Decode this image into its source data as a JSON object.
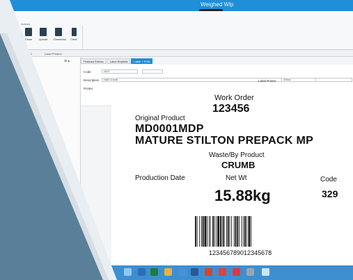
{
  "window": {
    "title": "Weighed Wlp"
  },
  "ribbon": {
    "group_label": "Actions",
    "buttons": [
      {
        "label": "Close",
        "icon": "close-icon"
      },
      {
        "label": "Upload",
        "icon": "upload-icon"
      },
      {
        "label": "Download",
        "icon": "download-icon"
      },
      {
        "label": "Clear",
        "icon": "trash-icon"
      }
    ],
    "sub_labels": [
      "Label",
      "Label Printers"
    ]
  },
  "tabs": [
    {
      "label": "Finished Entries",
      "active": false
    },
    {
      "label": "Label Reprints",
      "active": false
    },
    {
      "label": "Label + Print",
      "active": true
    }
  ],
  "form": {
    "code_label": "Code",
    "code_value": "1527",
    "description_label": "Description",
    "description_value": "Half Crumb",
    "printer_label": "Printer",
    "right_label": "Label Printer",
    "right_value": "Zebra"
  },
  "label": {
    "work_order_caption": "Work Order",
    "work_order_value": "123456",
    "original_product_caption": "Original Product",
    "original_product_code": "MD0001MDP",
    "original_product_desc": "MATURE STILTON PREPACK MP",
    "waste_caption": "Waste/By Product",
    "waste_value": "CRUMB",
    "production_date_caption": "Production Date",
    "net_wt_caption": "Net Wt",
    "net_wt_value": "15.88kg",
    "code_caption": "Code",
    "code_value": "329",
    "barcode_number": "123456789012345678"
  },
  "taskbar": {
    "icons": [
      "globe-icon",
      "ie-icon",
      "excel-icon",
      "folder-icon",
      "app-icon",
      "word-icon",
      "powerpoint-icon",
      "chrome-icon",
      "outlook-icon",
      "pin-icon",
      "monitor-icon"
    ]
  },
  "colors": {
    "titlebar": "#1f8fd8",
    "taskbar": "#3d8fd0",
    "overlay_dark": "#5a7f99",
    "overlay_light": "#e9eef2"
  }
}
